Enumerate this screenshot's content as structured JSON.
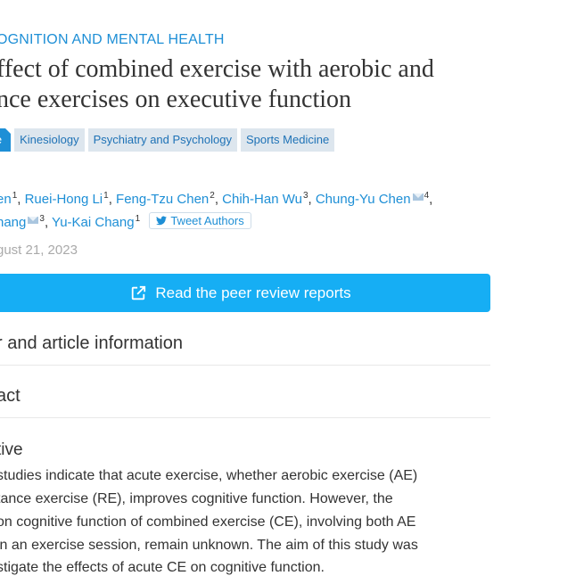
{
  "section": {
    "label": "OGNITION AND MENTAL HEALTH"
  },
  "title": {
    "line1": "ffect of combined exercise with aerobic and",
    "line2": "nce exercises on executive function"
  },
  "tags": [
    {
      "label": "le"
    },
    {
      "label": "Kinesiology"
    },
    {
      "label": "Psychiatry and Psychology"
    },
    {
      "label": "Sports Medicine"
    }
  ],
  "authors": {
    "row1": [
      {
        "name": "en",
        "sup": "1"
      },
      {
        "name": "Ruei-Hong Li",
        "sup": "1"
      },
      {
        "name": "Feng-Tzu Chen",
        "sup": "2"
      },
      {
        "name": "Chih-Han Wu",
        "sup": "3"
      },
      {
        "name": "Chung-Yu Chen",
        "sup": "4"
      }
    ],
    "row2": [
      {
        "name": "hang",
        "sup": "3"
      },
      {
        "name": "Yu-Kai Chang",
        "sup": "1"
      }
    ],
    "tweet_label": "Tweet Authors"
  },
  "date": "gust 21, 2023",
  "review_button": {
    "label": "Read the peer review reports"
  },
  "sections": {
    "author_info": "r and article information",
    "abstract": "act"
  },
  "objective": {
    "heading": "tive",
    "lines": [
      "studies indicate that acute exercise, whether aerobic exercise (AE)",
      "tance exercise (RE), improves cognitive function. However, the",
      "on cognitive function of combined exercise (CE), involving both AE",
      "in an exercise session, remain unknown. The aim of this study was",
      "stigate the effects of acute CE on cognitive function."
    ]
  },
  "colors": {
    "accent": "#1e8fd6",
    "button": "#16aef4",
    "tag_bg": "#dde6ee"
  },
  "icons": {
    "external_link": "external-link-icon",
    "twitter": "twitter-icon",
    "mail": "mail-icon"
  }
}
